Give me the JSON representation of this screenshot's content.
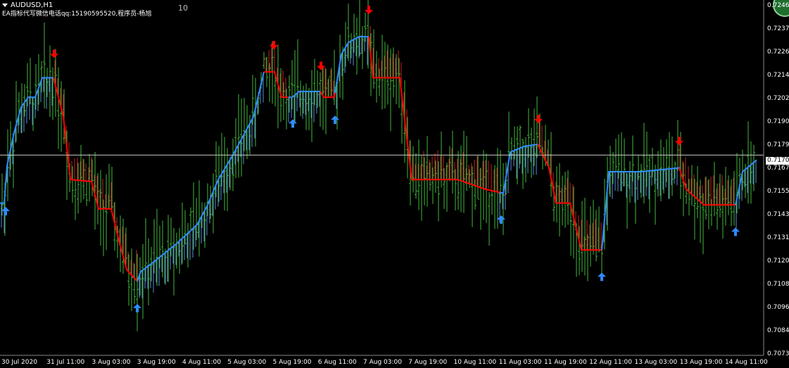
{
  "header": {
    "symbol": "AUDUSD,H1",
    "note": "EA指标代写微信电话qq:15190595520,程序员-杨旭",
    "counter": "10"
  },
  "current_price_label": "0.71705",
  "chart_data": {
    "type": "ohlc",
    "title": "AUDUSD,H1",
    "y_tick_labels": [
      "0.72460",
      "0.72375",
      "0.72265",
      "0.72140",
      "0.72025",
      "0.71905",
      "0.71790",
      "0.71670",
      "0.71550",
      "0.71435",
      "0.71315",
      "0.71200",
      "0.71080",
      "0.70965",
      "0.70845",
      "0.70730"
    ],
    "x_tick_labels": [
      "30 Jul 2020",
      "31 Jul 11:00",
      "3 Aug 03:00",
      "3 Aug 19:00",
      "4 Aug 11:00",
      "5 Aug 03:00",
      "5 Aug 19:00",
      "6 Aug 11:00",
      "7 Aug 03:00",
      "7 Aug 19:00",
      "10 Aug 11:00",
      "11 Aug 03:00",
      "11 Aug 19:00",
      "12 Aug 11:00",
      "13 Aug 03:00",
      "13 Aug 19:00",
      "14 Aug 11:00"
    ],
    "ylim": [
      0.707,
      0.7249
    ],
    "current_price": 0.71705,
    "trend_line": [
      [
        0,
        0.7146
      ],
      [
        6,
        0.7146
      ],
      [
        10,
        0.7165
      ],
      [
        20,
        0.7182
      ],
      [
        30,
        0.7195
      ],
      [
        40,
        0.72
      ],
      [
        50,
        0.72
      ],
      [
        60,
        0.721
      ],
      [
        76,
        0.721
      ],
      [
        90,
        0.719
      ],
      [
        100,
        0.7158
      ],
      [
        130,
        0.7157
      ],
      [
        140,
        0.7143
      ],
      [
        158,
        0.7143
      ],
      [
        168,
        0.7128
      ],
      [
        180,
        0.7112
      ],
      [
        195,
        0.7106
      ],
      [
        200,
        0.7111
      ],
      [
        215,
        0.7115
      ],
      [
        250,
        0.7125
      ],
      [
        280,
        0.7135
      ],
      [
        295,
        0.7145
      ],
      [
        310,
        0.7158
      ],
      [
        330,
        0.717
      ],
      [
        345,
        0.718
      ],
      [
        360,
        0.719
      ],
      [
        375,
        0.7213
      ],
      [
        390,
        0.7213
      ],
      [
        400,
        0.72
      ],
      [
        415,
        0.72
      ],
      [
        425,
        0.7203
      ],
      [
        455,
        0.7203
      ],
      [
        460,
        0.72
      ],
      [
        475,
        0.72
      ],
      [
        485,
        0.7222
      ],
      [
        495,
        0.7228
      ],
      [
        510,
        0.7231
      ],
      [
        524,
        0.7231
      ],
      [
        530,
        0.721
      ],
      [
        568,
        0.721
      ],
      [
        576,
        0.7185
      ],
      [
        585,
        0.7158
      ],
      [
        650,
        0.7158
      ],
      [
        690,
        0.7153
      ],
      [
        715,
        0.7151
      ],
      [
        725,
        0.7172
      ],
      [
        745,
        0.7175
      ],
      [
        764,
        0.7176
      ],
      [
        780,
        0.7164
      ],
      [
        790,
        0.7146
      ],
      [
        810,
        0.7146
      ],
      [
        826,
        0.7122
      ],
      [
        855,
        0.7122
      ],
      [
        865,
        0.7162
      ],
      [
        910,
        0.7162
      ],
      [
        965,
        0.7164
      ],
      [
        975,
        0.7153
      ],
      [
        1000,
        0.7145
      ],
      [
        1045,
        0.7145
      ],
      [
        1055,
        0.7162
      ],
      [
        1075,
        0.7168
      ]
    ],
    "color_change_points": [
      [
        0,
        "blue"
      ],
      [
        76,
        "red"
      ],
      [
        195,
        "blue"
      ],
      [
        375,
        "red"
      ],
      [
        410,
        "blue"
      ],
      [
        455,
        "red"
      ],
      [
        476,
        "blue"
      ],
      [
        524,
        "red"
      ],
      [
        710,
        "blue"
      ],
      [
        764,
        "red"
      ],
      [
        855,
        "blue"
      ],
      [
        965,
        "red"
      ],
      [
        1045,
        "blue"
      ]
    ],
    "arrows": [
      {
        "type": "up",
        "x": 8
      },
      {
        "type": "down",
        "x": 77
      },
      {
        "type": "up",
        "x": 195
      },
      {
        "type": "down",
        "x": 389
      },
      {
        "type": "up",
        "x": 416
      },
      {
        "type": "down",
        "x": 456
      },
      {
        "type": "up",
        "x": 476
      },
      {
        "type": "down",
        "x": 524
      },
      {
        "type": "up",
        "x": 712
      },
      {
        "type": "down",
        "x": 765
      },
      {
        "type": "up",
        "x": 855
      },
      {
        "type": "down",
        "x": 965
      },
      {
        "type": "up",
        "x": 1045
      }
    ],
    "colors": {
      "up_bar": "#42b83b",
      "bull_line": "#2f8cff",
      "bear_line": "#ff0000",
      "bull_hist": "#5b8ed8",
      "bear_hist": "#c42525",
      "up_arrow": "#2f8cff",
      "down_arrow": "#ff0000",
      "current": "#c8c8c8"
    }
  }
}
